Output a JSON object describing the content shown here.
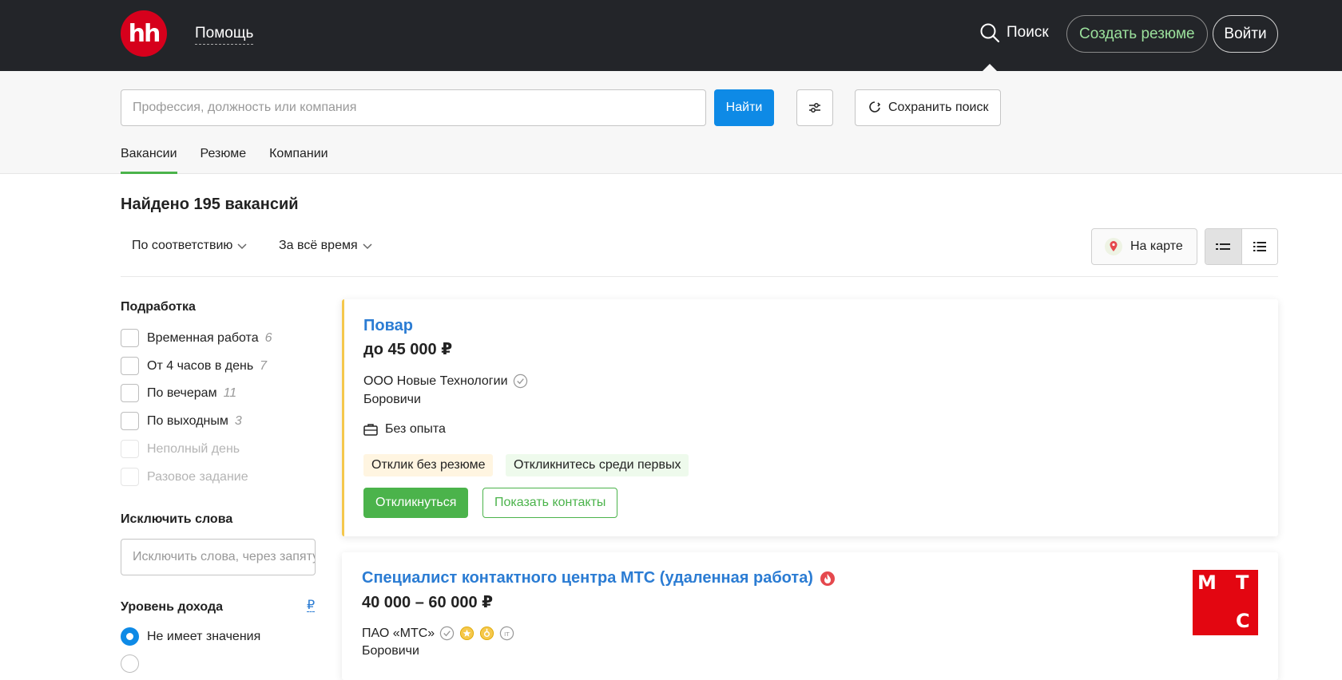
{
  "header": {
    "logo_text": "hh",
    "help_label": "Помощь",
    "search_label": "Поиск",
    "create_resume_label": "Создать резюме",
    "login_label": "Войти"
  },
  "search": {
    "placeholder": "Профессия, должность или компания",
    "find_label": "Найти",
    "save_label": "Сохранить поиск",
    "tabs": [
      {
        "label": "Вакансии",
        "active": true
      },
      {
        "label": "Резюме",
        "active": false
      },
      {
        "label": "Компании",
        "active": false
      }
    ]
  },
  "results": {
    "found_text": "Найдено 195 вакансий",
    "sort_label": "По соответствию",
    "period_label": "За всё время",
    "map_label": "На карте"
  },
  "sidebar": {
    "parttime_title": "Подработка",
    "parttime_items": [
      {
        "label": "Временная работа",
        "count": "6",
        "disabled": false
      },
      {
        "label": "От 4 часов в день",
        "count": "7",
        "disabled": false
      },
      {
        "label": "По вечерам",
        "count": "11",
        "disabled": false
      },
      {
        "label": "По выходным",
        "count": "3",
        "disabled": false
      },
      {
        "label": "Неполный день",
        "count": "",
        "disabled": true
      },
      {
        "label": "Разовое задание",
        "count": "",
        "disabled": true
      }
    ],
    "exclude_title": "Исключить слова",
    "exclude_placeholder": "Исключить слова, через запятую",
    "income_title": "Уровень дохода",
    "currency_symbol": "₽",
    "income_option": "Не имеет значения"
  },
  "vacancies": [
    {
      "title": "Повар",
      "salary": "до 45 000 ₽",
      "company": "ООО Новые Технологии",
      "city": "Боровичи",
      "experience": "Без опыта",
      "chips": [
        "Отклик без резюме",
        "Откликнитесь среди первых"
      ],
      "apply_label": "Откликнуться",
      "contacts_label": "Показать контакты"
    },
    {
      "title": "Специалист контактного центра МТС (удаленная работа)",
      "salary": "40 000 – 60 000 ₽",
      "company": "ПАО «МТС»",
      "city": "Боровичи",
      "logo_letters": [
        "М",
        "Т",
        "С"
      ]
    }
  ],
  "colors": {
    "header_bg": "#232529",
    "brand_red": "#d6001c",
    "accent_blue": "#0e8ae6",
    "accent_green": "#4bb34b",
    "link_blue": "#2b7cd3"
  }
}
